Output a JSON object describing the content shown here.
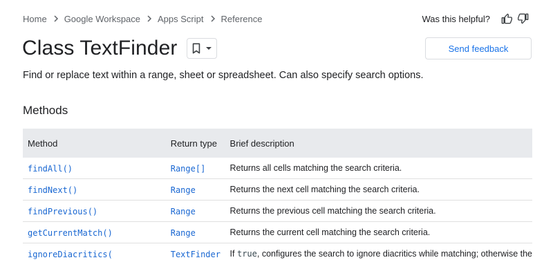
{
  "breadcrumb": {
    "items": [
      "Home",
      "Google Workspace",
      "Apps Script",
      "Reference"
    ]
  },
  "helpful": {
    "label": "Was this helpful?"
  },
  "title": "Class TextFinder",
  "feedback_label": "Send feedback",
  "description": "Find or replace text within a range, sheet or spreadsheet. Can also specify search options.",
  "methods_section_title": "Methods",
  "table": {
    "headers": {
      "method": "Method",
      "return_type": "Return type",
      "brief": "Brief description"
    },
    "rows": [
      {
        "method": "findAll()",
        "return_type": "Range[]",
        "brief": "Returns all cells matching the search criteria."
      },
      {
        "method": "findNext()",
        "return_type": "Range",
        "brief": "Returns the next cell matching the search criteria."
      },
      {
        "method": "findPrevious()",
        "return_type": "Range",
        "brief": "Returns the previous cell matching the search criteria."
      },
      {
        "method": "getCurrentMatch()",
        "return_type": "Range",
        "brief": "Returns the current cell matching the search criteria."
      },
      {
        "method": "ignoreDiacritics(",
        "return_type": "TextFinder",
        "brief_prefix": "If",
        "brief_code": "true",
        "brief_suffix": ", configures the search to ignore diacritics while matching; otherwise the"
      }
    ]
  },
  "icons": {
    "thumb_up": "thumb-up-icon",
    "thumb_down": "thumb-down-icon",
    "bookmark": "bookmark-icon",
    "dropdown": "arrow-drop-down-icon",
    "chevron": "chevron-right-icon"
  },
  "colors": {
    "link": "#1967d2",
    "header_bg": "#e8eaed",
    "text": "#202124",
    "muted": "#5f6368"
  }
}
